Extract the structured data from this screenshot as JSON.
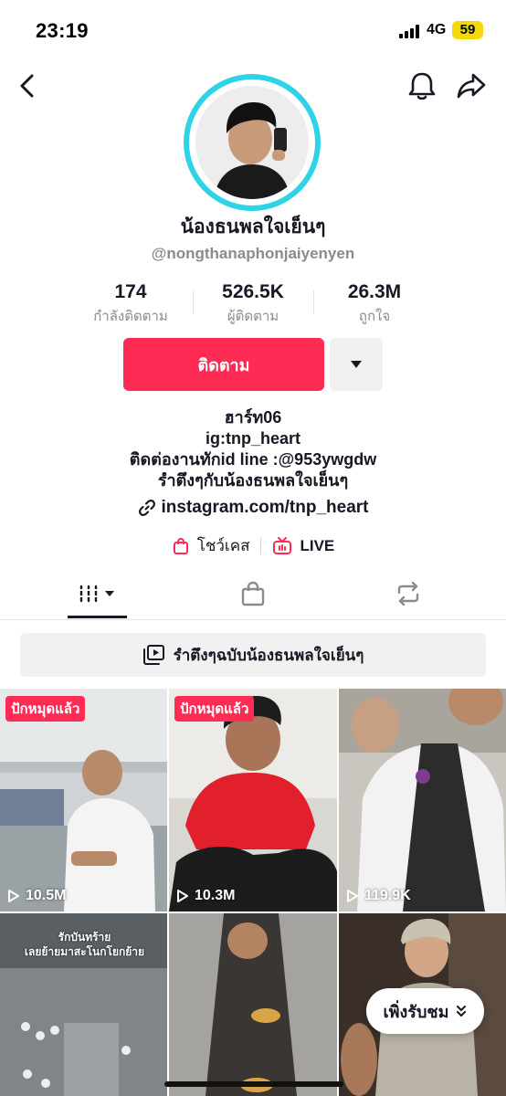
{
  "status_bar": {
    "time": "23:19",
    "network": "4G",
    "battery": "59"
  },
  "header": {
    "back_icon": "chevron-left-icon",
    "bell_icon": "bell-icon",
    "share_icon": "share-arrow-icon"
  },
  "profile": {
    "display_name": "น้องธนพลใจเย็นๆ",
    "username": "@nongthanaphonjaiyenyen",
    "ring_color": "#2fd3e8"
  },
  "stats": [
    {
      "value": "174",
      "label": "กำลังติดตาม"
    },
    {
      "value": "526.5K",
      "label": "ผู้ติดตาม"
    },
    {
      "value": "26.3M",
      "label": "ถูกใจ"
    }
  ],
  "actions": {
    "follow_label": "ติดตาม",
    "follow_color": "#fe2c55",
    "more_icon": "caret-down-icon"
  },
  "bio": {
    "lines": [
      "ฮาร์ท06",
      "ig:tnp_heart",
      "ติดต่องานทักid line :@953ywgdw",
      "รำตึงๆกับน้องธนพลใจเย็นๆ"
    ],
    "link": "instagram.com/tnp_heart"
  },
  "chips": {
    "showcase": "โชว์เคส",
    "live": "LIVE"
  },
  "tabs": {
    "videos_icon": "grid-icon",
    "shop_icon": "shopping-bag-icon",
    "repost_icon": "repost-icon"
  },
  "playlist": {
    "label": "รำตึงๆฉบับน้องธนพลใจเย็นๆ"
  },
  "videos": [
    {
      "pinned": "ปักหมุดแล้ว",
      "views": "10.5M"
    },
    {
      "pinned": "ปักหมุดแล้ว",
      "views": "10.3M"
    },
    {
      "views": "119.9K"
    },
    {
      "caption_line1": "รักบันทร้าย",
      "caption_line2": "เลยย้ายมาสะโนกโยกย้าย"
    },
    {},
    {}
  ],
  "watch_more": {
    "label": "เพิ่งรับชม"
  }
}
